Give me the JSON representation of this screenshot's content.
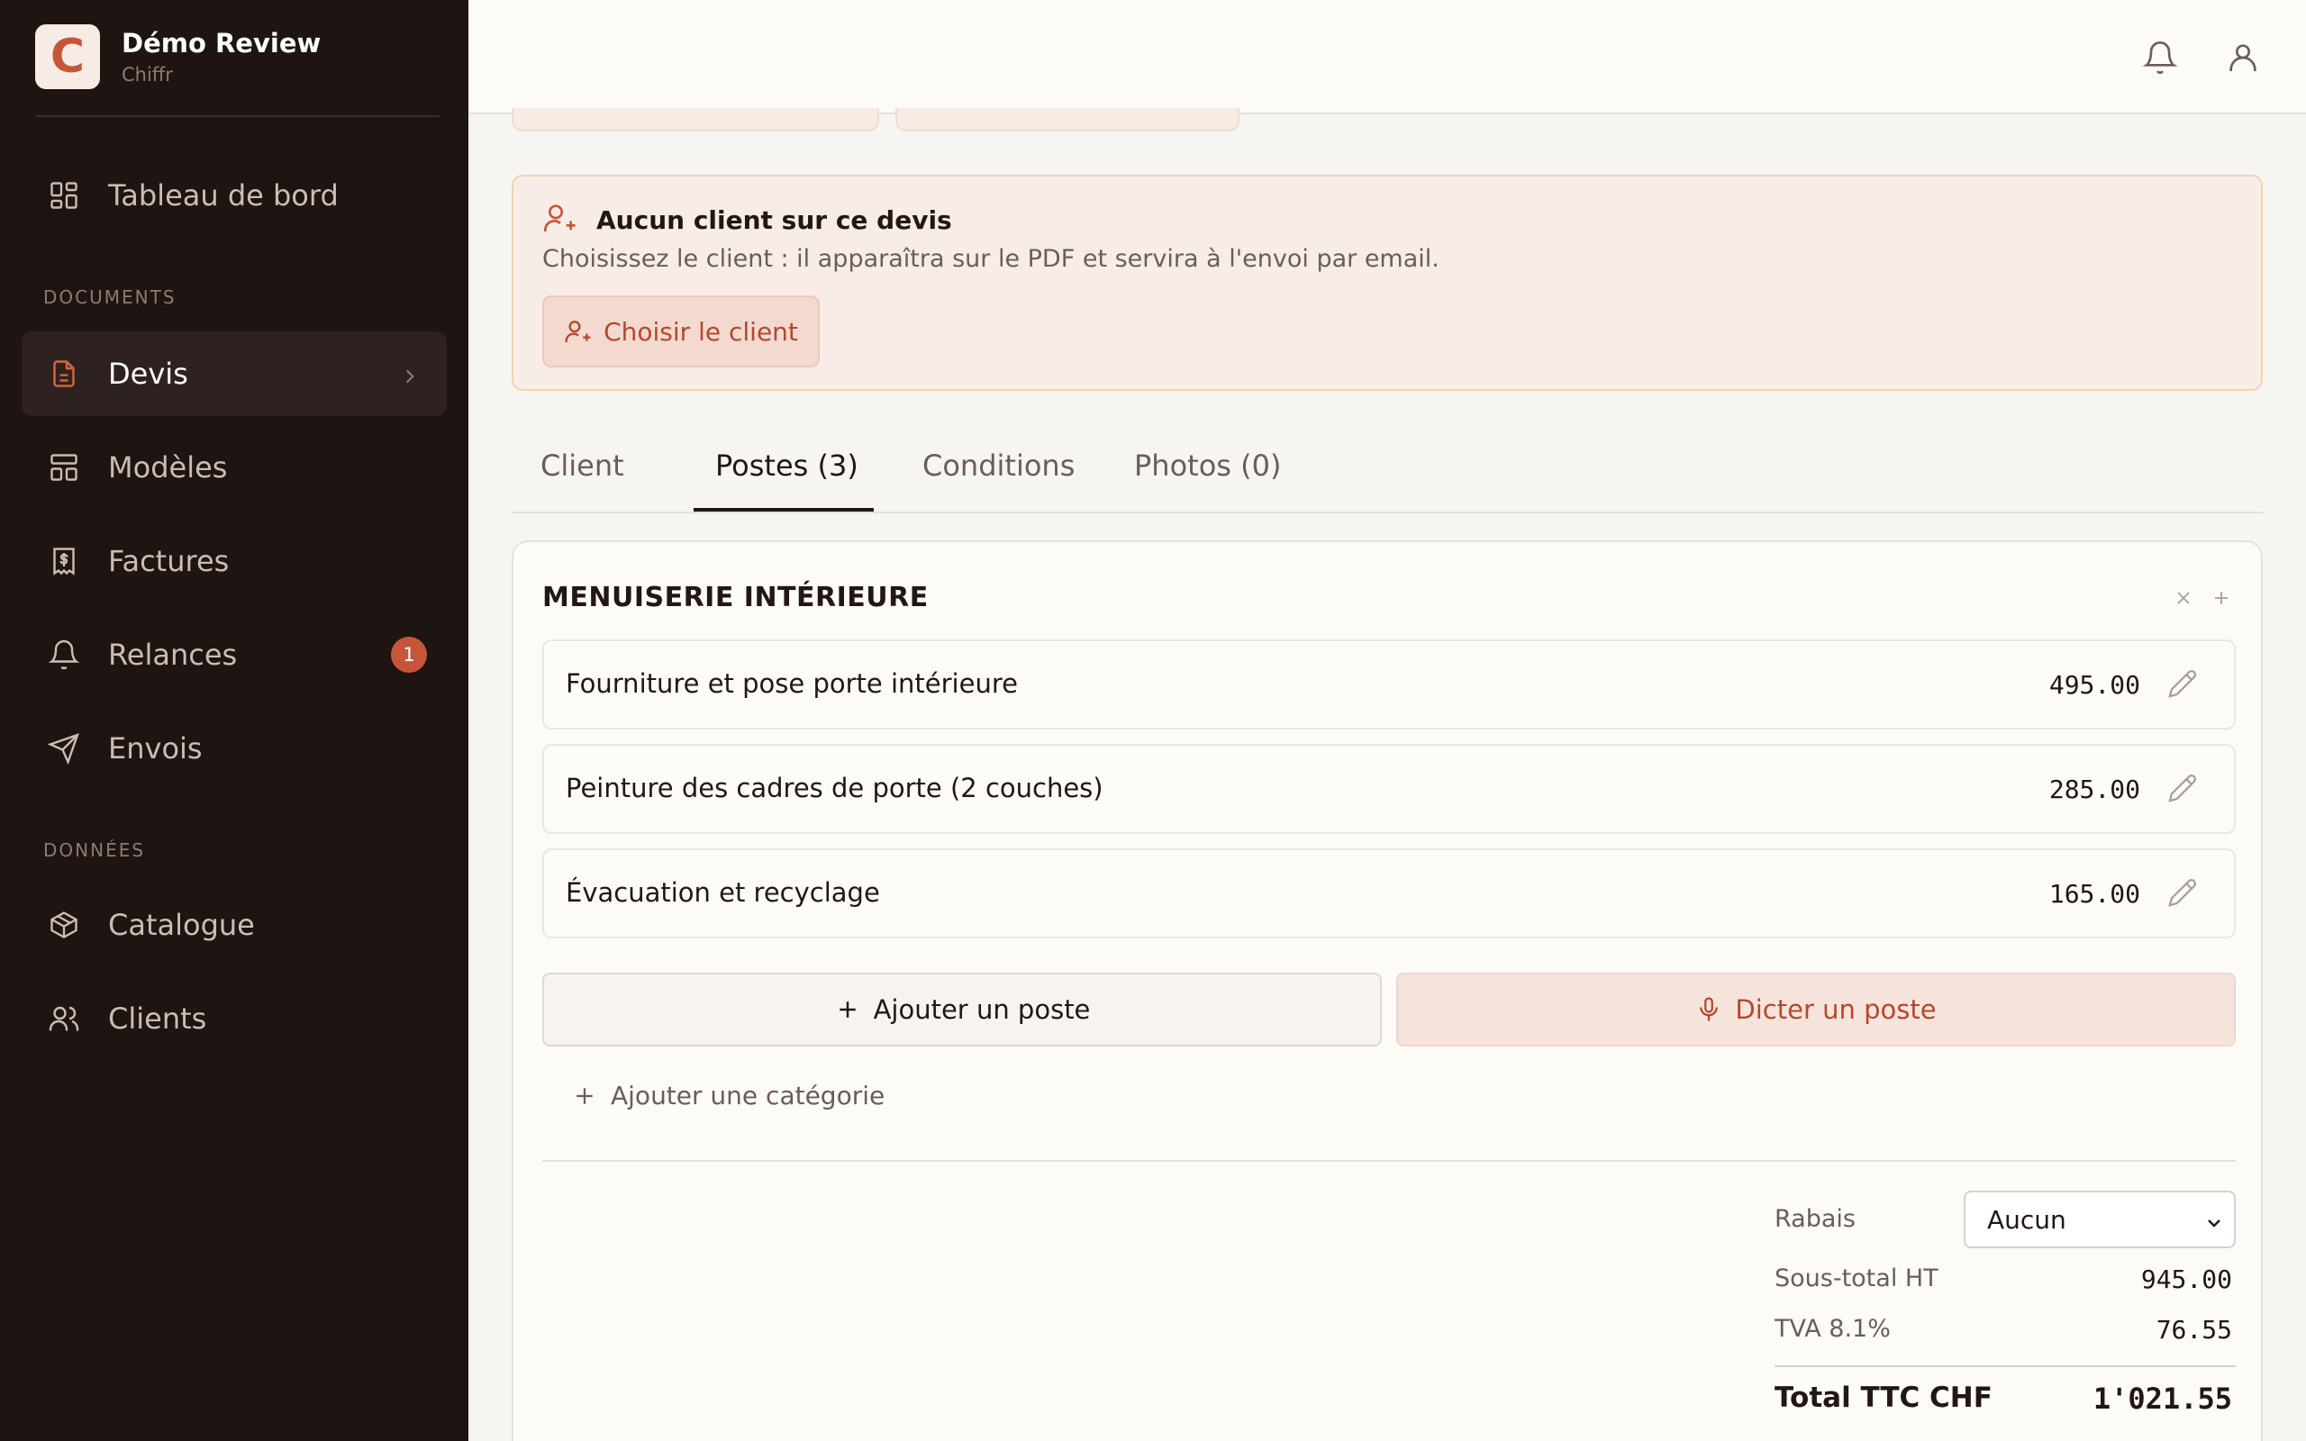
{
  "brand": {
    "title": "Démo Review",
    "subtitle": "Chiffr",
    "logo_letter": "C"
  },
  "sidebar": {
    "dashboard": "Tableau de bord",
    "section_documents": "DOCUMENTS",
    "devis": "Devis",
    "modeles": "Modèles",
    "factures": "Factures",
    "relances": "Relances",
    "relances_badge": "1",
    "envois": "Envois",
    "section_donnees": "DONNÉES",
    "catalogue": "Catalogue",
    "clients": "Clients"
  },
  "alert": {
    "title": "Aucun client sur ce devis",
    "text": "Choisissez le client : il apparaîtra sur le PDF et servira à l'envoi par email.",
    "button": "Choisir le client"
  },
  "tabs": {
    "client": "Client",
    "postes": "Postes (3)",
    "conditions": "Conditions",
    "photos": "Photos (0)"
  },
  "category": {
    "title": "MENUISERIE INTÉRIEURE",
    "lines": [
      {
        "description": "Fourniture et pose porte intérieure",
        "amount": "495.00"
      },
      {
        "description": "Peinture des cadres de porte (2 couches)",
        "amount": "285.00"
      },
      {
        "description": "Évacuation et recyclage",
        "amount": "165.00"
      }
    ]
  },
  "actions": {
    "add_line": "Ajouter un poste",
    "dictate_line": "Dicter un poste",
    "add_category": "Ajouter une catégorie"
  },
  "totals": {
    "rabais_label": "Rabais",
    "rabais_value": "Aucun",
    "subtotal_label": "Sous-total HT",
    "subtotal_value": "945.00",
    "tva_label": "TVA 8.1%",
    "tva_value": "76.55",
    "total_label": "Total TTC CHF",
    "total_value": "1'021.55"
  },
  "colors": {
    "accent": "#c6563a",
    "sidebar_bg": "#1e1411",
    "alert_bg": "#f8ece6"
  }
}
